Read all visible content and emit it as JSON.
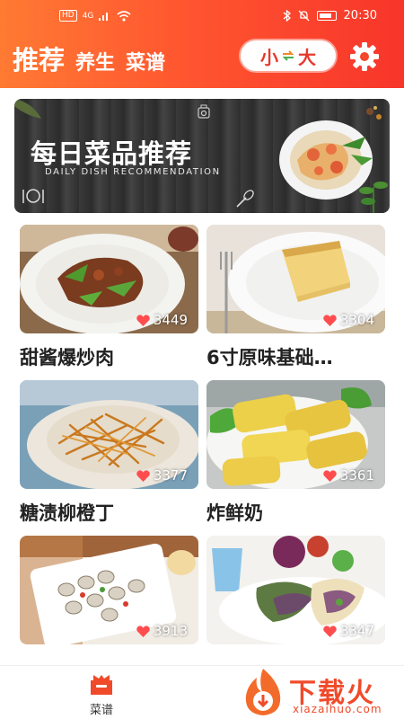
{
  "status_bar": {
    "hd_label": "HD",
    "signal_label": "4G",
    "time": "20:30"
  },
  "header": {
    "tabs": [
      {
        "label": "推荐",
        "active": true
      },
      {
        "label": "养生",
        "active": false
      },
      {
        "label": "菜谱",
        "active": false
      }
    ],
    "size_toggle": {
      "small": "小",
      "large": "大"
    },
    "settings_icon": "gear-icon"
  },
  "banner": {
    "title": "每日菜品推荐",
    "subtitle": "DAILY DISH RECOMMENDATION"
  },
  "recipes": [
    {
      "title": "甜酱爆炒肉",
      "likes": "3449"
    },
    {
      "title": "6寸原味基础…",
      "likes": "3304"
    },
    {
      "title": "糖渍柳橙丁",
      "likes": "3377"
    },
    {
      "title": "炸鲜奶",
      "likes": "3361"
    },
    {
      "title": "",
      "likes": "3913"
    },
    {
      "title": "",
      "likes": "3347"
    }
  ],
  "bottom_nav": {
    "items": [
      {
        "label": "菜谱",
        "icon": "recipe-book-icon"
      }
    ]
  },
  "watermark": {
    "text": "下载火",
    "url": "xiazaihuo.com"
  },
  "colors": {
    "header_start": "#ff7a33",
    "header_end": "#f7352a",
    "accent": "#e6392d",
    "heart": "#ff4d4f"
  }
}
